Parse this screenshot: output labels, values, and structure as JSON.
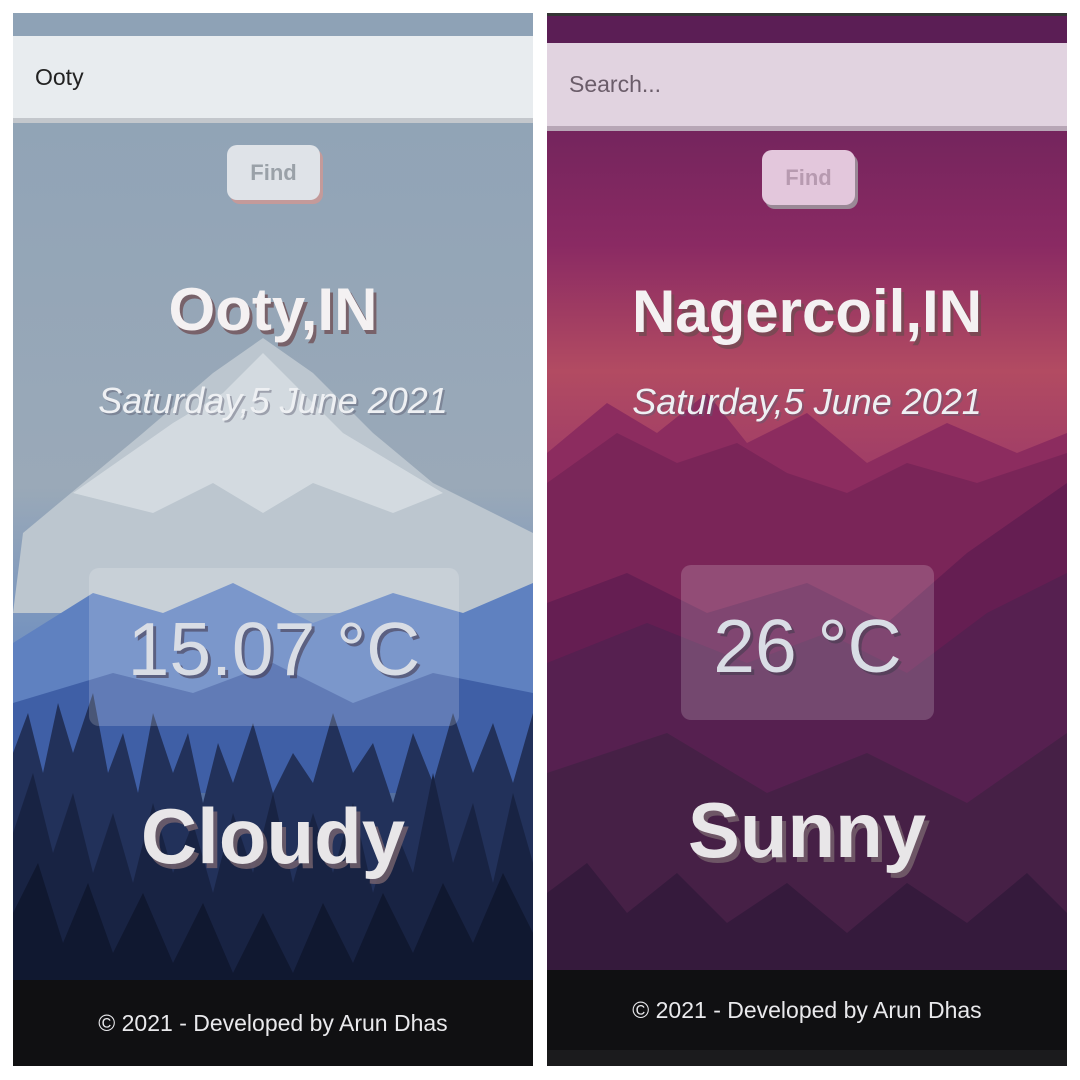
{
  "left": {
    "search": {
      "value": "Ooty",
      "placeholder": "Search..."
    },
    "find_label": "Find",
    "city": "Ooty,IN",
    "date": "Saturday,5 June 2021",
    "temperature": "15.07 °C",
    "condition": "Cloudy",
    "footer": "© 2021 - Developed by Arun Dhas"
  },
  "right": {
    "search": {
      "value": "",
      "placeholder": "Search..."
    },
    "find_label": "Find",
    "city": "Nagercoil,IN",
    "date": "Saturday,5 June 2021",
    "temperature": "26 °C",
    "condition": "Sunny",
    "footer": "© 2021 - Developed by Arun Dhas"
  },
  "colors": {
    "left_sky": "#8ea2b6",
    "left_trees": "#1a2546",
    "right_sky": "#7a2457",
    "right_mountains": "#4a1c48",
    "footer_bg": "#101012"
  }
}
